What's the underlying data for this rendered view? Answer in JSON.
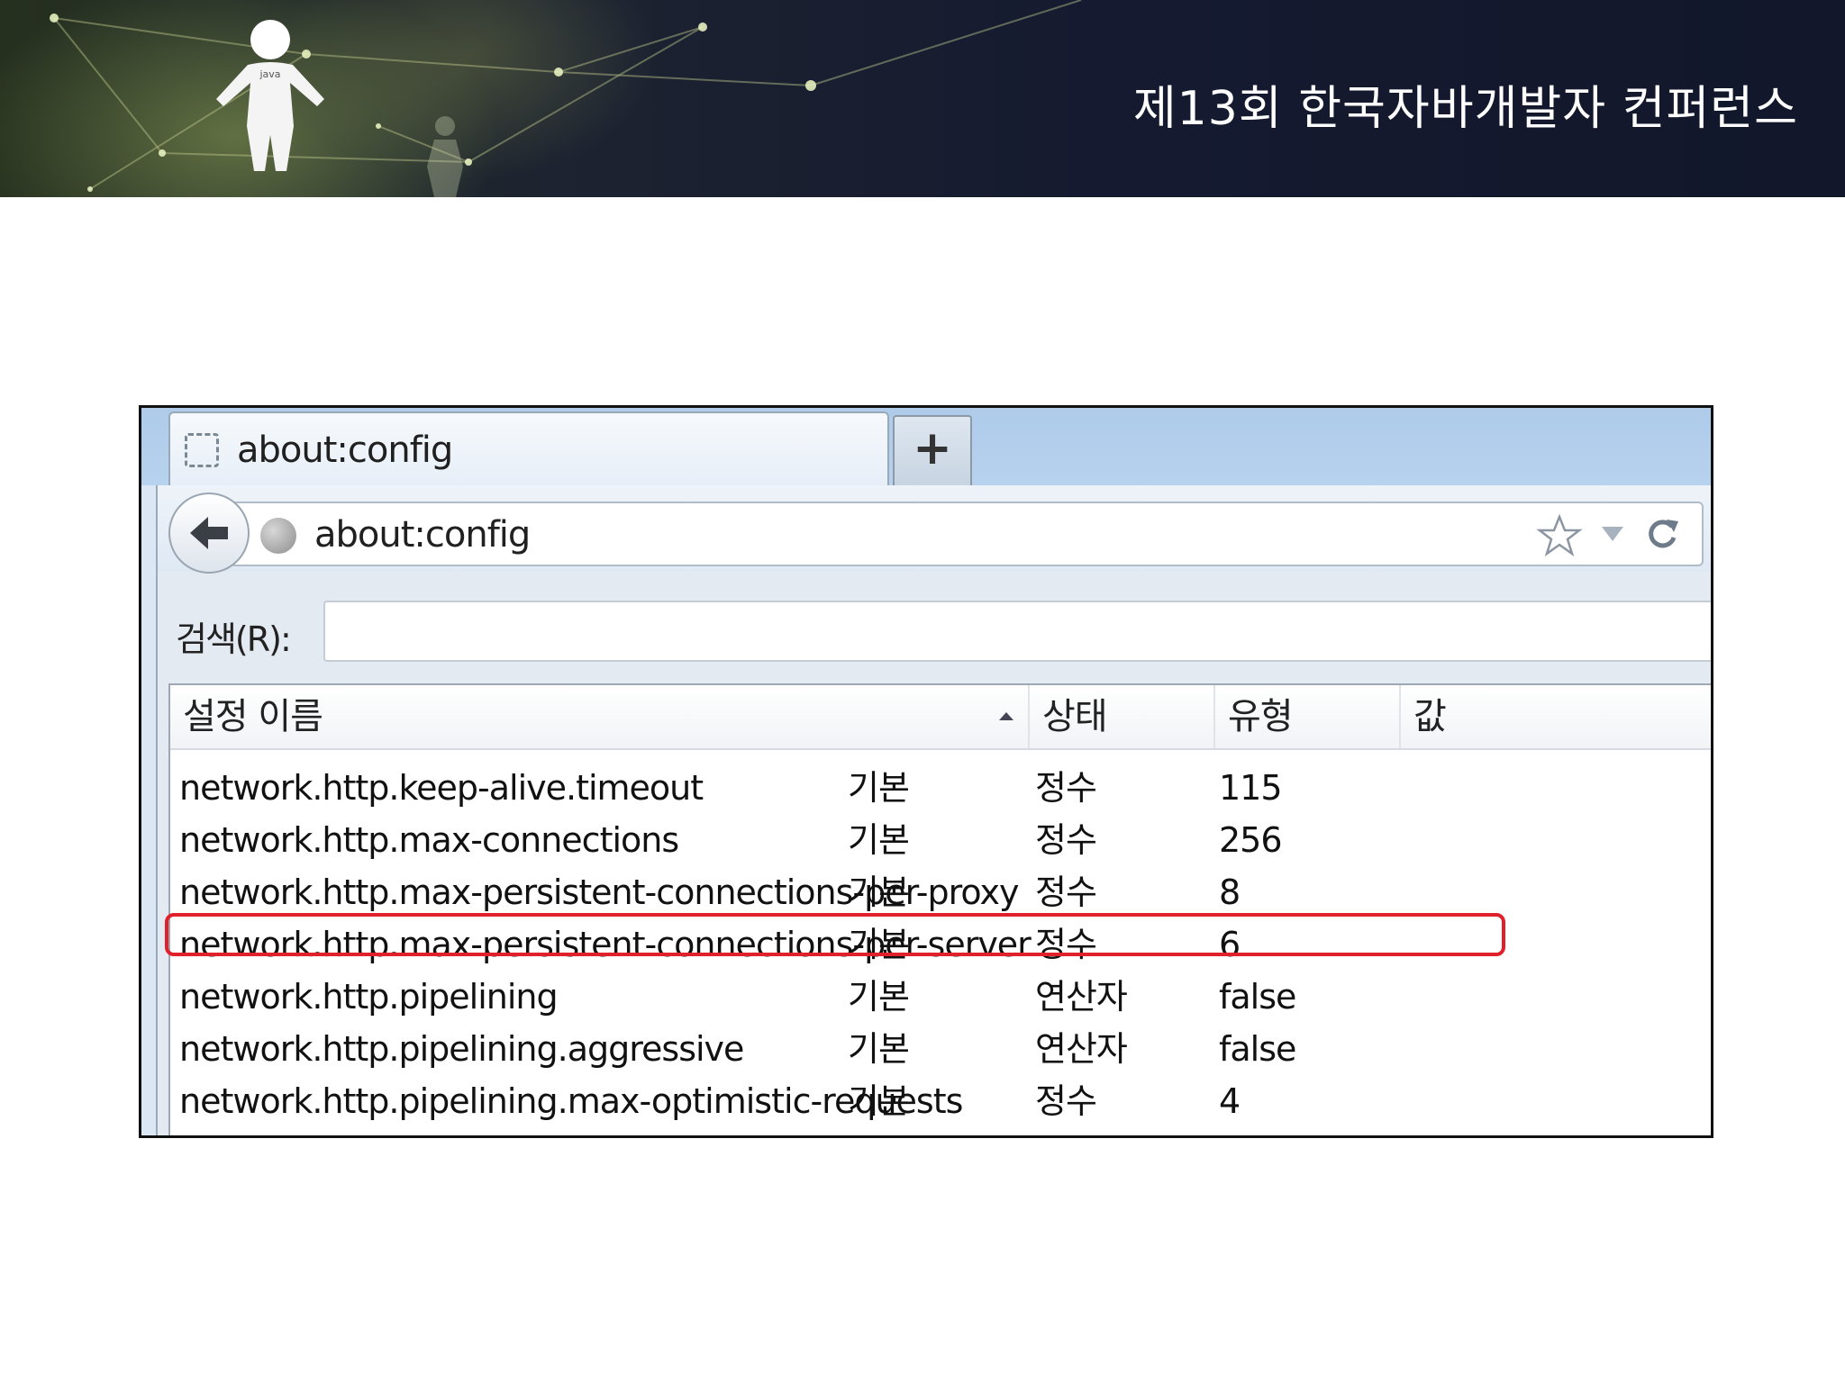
{
  "slide": {
    "conference_title": "제13회 한국자바개발자 컨퍼런스",
    "logo_text": "java"
  },
  "browser": {
    "tab": {
      "title": "about:config",
      "favicon": "blank-page-icon"
    },
    "new_tab_label": "+",
    "url": "about:config",
    "icons": {
      "back": "back-arrow-icon",
      "site": "globe-icon",
      "bookmark": "star-icon",
      "history": "dropdown-triangle-icon",
      "reload": "reload-icon"
    }
  },
  "config": {
    "search_label": "검색(R):",
    "search_value": "",
    "columns": [
      "설정 이름",
      "상태",
      "유형",
      "값"
    ],
    "rows": [
      {
        "name": "network.http.keep-alive.timeout",
        "status": "기본",
        "type": "정수",
        "value": "115"
      },
      {
        "name": "network.http.max-connections",
        "status": "기본",
        "type": "정수",
        "value": "256"
      },
      {
        "name": "network.http.max-persistent-connections-per-proxy",
        "status": "기본",
        "type": "정수",
        "value": "8"
      },
      {
        "name": "network.http.max-persistent-connections-per-server",
        "status": "기본",
        "type": "정수",
        "value": "6"
      },
      {
        "name": "network.http.pipelining",
        "status": "기본",
        "type": "연산자",
        "value": "false"
      },
      {
        "name": "network.http.pipelining.aggressive",
        "status": "기본",
        "type": "연산자",
        "value": "false"
      },
      {
        "name": "network.http.pipelining.max-optimistic-requests",
        "status": "기본",
        "type": "정수",
        "value": "4"
      }
    ],
    "highlighted_row": 3,
    "highlight_color": "#e0202a"
  }
}
